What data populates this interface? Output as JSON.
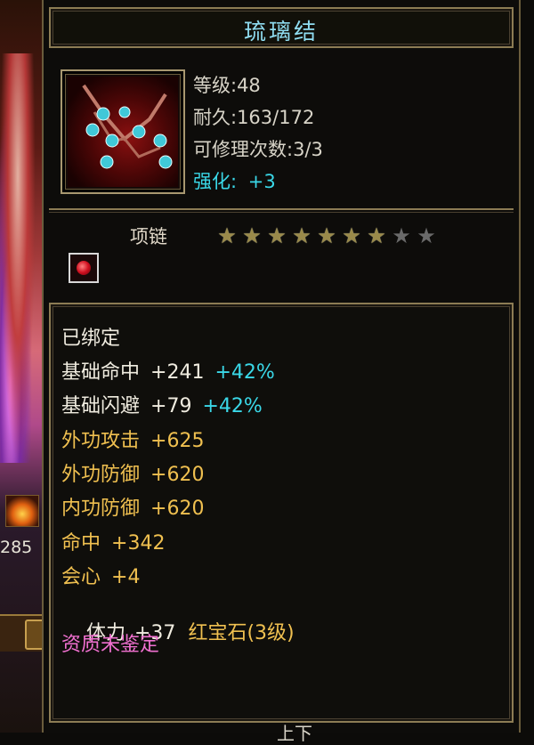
{
  "item": {
    "name": "琉璃结",
    "stats": {
      "level": "等级:48",
      "durability": "耐久:163/172",
      "repairs": "可修理次数:3/3",
      "enhance_label": "强化:",
      "enhance_value": "+3"
    },
    "type": "项链",
    "stars": {
      "filled": 7,
      "total": 9
    },
    "bound": "已绑定",
    "attributes": [
      {
        "name": "基础命中",
        "value": "+241",
        "bonus": "+42%",
        "color": "white"
      },
      {
        "name": "基础闪避",
        "value": "+79",
        "bonus": "+42%",
        "color": "white"
      },
      {
        "name": "外功攻击",
        "value": "+625",
        "bonus": "",
        "color": "gold"
      },
      {
        "name": "外功防御",
        "value": "+620",
        "bonus": "",
        "color": "gold"
      },
      {
        "name": "内功防御",
        "value": "+620",
        "bonus": "",
        "color": "gold"
      },
      {
        "name": "命中",
        "value": "+342",
        "bonus": "",
        "color": "gold"
      },
      {
        "name": "会心",
        "value": "+4",
        "bonus": "",
        "color": "gold"
      }
    ],
    "gem_line": {
      "name": "体力",
      "value": "+37",
      "gem": "红宝石(3级)"
    },
    "quality": "资质未鉴定",
    "bottom_partial": "上下"
  },
  "scene": {
    "number": "285"
  },
  "colors": {
    "title": "#8fdcf0",
    "enhance": "#3ad8e8",
    "attr_gold": "#f0c050",
    "quality_pink": "#f070d0",
    "frame": "#8c7c54"
  }
}
